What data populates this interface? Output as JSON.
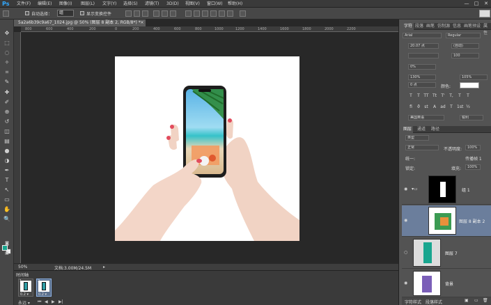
{
  "app": {
    "logo": "Ps"
  },
  "menu": [
    "文件(F)",
    "编辑(E)",
    "图像(I)",
    "图层(L)",
    "文字(Y)",
    "选择(S)",
    "滤镜(T)",
    "3D(D)",
    "视图(V)",
    "窗口(W)",
    "帮助(H)"
  ],
  "window_controls": [
    "—",
    "□",
    "✕"
  ],
  "options": {
    "auto_select_label": "自动选择：",
    "auto_select_value": "组",
    "show_transform_label": "显示变换控件"
  },
  "document_tab": {
    "title": "5a2a6b39c9a67_1024.jpg @ 50% (图层 8 副本 2, RGB/8*) *",
    "close": "×"
  },
  "ruler": [
    "800",
    "600",
    "400",
    "200",
    "0",
    "200",
    "400",
    "600",
    "800",
    "1000",
    "1200",
    "1400",
    "1600",
    "1800",
    "2000",
    "2200"
  ],
  "tools": [
    "move-tool-icon",
    "marquee-icon",
    "lasso-icon",
    "quick-select-icon",
    "crop-icon",
    "eyedropper-icon",
    "healing-icon",
    "brush-icon",
    "stamp-icon",
    "history-brush-icon",
    "eraser-icon",
    "gradient-icon",
    "blur-icon",
    "dodge-icon",
    "pen-icon",
    "type-icon",
    "path-select-icon",
    "shape-icon",
    "hand-icon",
    "zoom-icon"
  ],
  "tool_glyphs": [
    "✥",
    "⬚",
    "◌",
    "✧",
    "⌗",
    "✎",
    "✚",
    "✐",
    "⊕",
    "↺",
    "◫",
    "▤",
    "●",
    "◑",
    "✒",
    "T",
    "↖",
    "▭",
    "✋",
    "🔍"
  ],
  "colors": {
    "foreground": "#19a68f",
    "background": "#eeeeee",
    "accent": "#31a8ff"
  },
  "status": {
    "zoom": "50%",
    "doc": "文档:3.00M/24.5M"
  },
  "timeline": {
    "tab": "时间轴",
    "frames": [
      {
        "num": "1",
        "delay": "0.2 ▾"
      },
      {
        "num": "2",
        "delay": "0.2 ▾"
      }
    ],
    "loop": "永远 ▾",
    "controls": [
      "⏮",
      "◀",
      "▶",
      "▶|"
    ]
  },
  "character_panel": {
    "tabs": [
      "字符",
      "段落",
      "画笔",
      "仿制源",
      "信息",
      "画笔预设",
      "属性"
    ],
    "font_family": "Arial",
    "font_style": "Regular",
    "size": "20.07 点",
    "leading": "(自动)",
    "kerning": "",
    "tracking": "100",
    "vertical_scale_pct": "0%",
    "horizontal_scale": "130%",
    "vertical_scale": "105%",
    "baseline": "0 点",
    "color_label": "颜色:",
    "type_buttons": [
      "T",
      "T",
      "TT",
      "Tt",
      "T'",
      "T,",
      "T",
      "T"
    ],
    "extra_buttons": [
      "fi",
      "ϑ",
      "st",
      "A",
      "ad",
      "T",
      "1st",
      "½"
    ],
    "language": "美国英语",
    "antialias": "锐利"
  },
  "layers_panel": {
    "tabs": [
      "图层",
      "通道",
      "路径"
    ],
    "filter_label": "类型",
    "blend_mode": "正常",
    "opacity_label": "不透明度:",
    "opacity": "100%",
    "lock_label": "锁定:",
    "fill_label": "填充:",
    "fill": "100%",
    "propagate_label": "传播帧 1",
    "unify_label": "统一:",
    "layers": [
      {
        "name": "组 1",
        "type": "group"
      },
      {
        "name": "图层 8 副本 2",
        "type": "layer"
      },
      {
        "name": "图层 7",
        "type": "layer"
      },
      {
        "name": "背景",
        "type": "background"
      }
    ],
    "bottom_tabs": [
      "字符样式",
      "段落样式"
    ],
    "footer_icons": [
      "link-icon",
      "fx-icon",
      "mask-icon",
      "adjustment-icon",
      "folder-icon",
      "new-layer-icon",
      "trash-icon"
    ]
  }
}
